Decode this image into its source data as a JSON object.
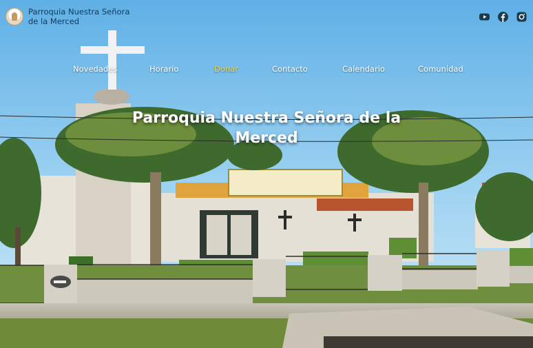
{
  "brand": {
    "name": "Parroquia Nuestra Señora de la Merced",
    "logo_icon": "virgin-mary-icon"
  },
  "social": [
    {
      "name": "youtube-icon"
    },
    {
      "name": "facebook-icon"
    },
    {
      "name": "instagram-icon"
    }
  ],
  "nav": {
    "items": [
      {
        "label": "Novedades"
      },
      {
        "label": "Horario"
      },
      {
        "label": "Donar",
        "active": true
      },
      {
        "label": "Contacto"
      },
      {
        "label": "Calendario"
      },
      {
        "label": "Comunidad"
      }
    ],
    "active_color": "#f5d547"
  },
  "hero": {
    "title": "Parroquia Nuestra Señora de la Merced"
  },
  "colors": {
    "sky": "#6fb6e6",
    "brand_text": "#0f3a5a",
    "social_icon": "#1a3a4f"
  }
}
